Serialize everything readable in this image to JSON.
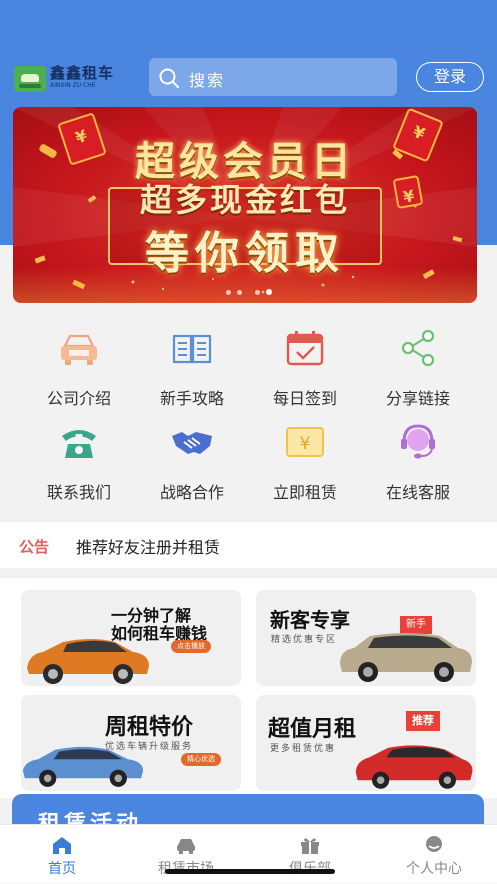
{
  "header": {
    "logo_name": "鑫鑫租车",
    "logo_sub": "XINXIN ZU CHE",
    "search_placeholder": "搜索",
    "login_label": "登录"
  },
  "banner": {
    "line1": "超级会员日",
    "line2": "超多现金红包",
    "line3": "等你领取",
    "slide_count": 4,
    "active_slide": 3
  },
  "menu": {
    "items": [
      {
        "label": "公司介绍",
        "icon": "company-car-icon",
        "color": "#f0a57a"
      },
      {
        "label": "新手攻略",
        "icon": "book-icon",
        "color": "#5b8fd6"
      },
      {
        "label": "每日签到",
        "icon": "calendar-check-icon",
        "color": "#e05a50"
      },
      {
        "label": "分享链接",
        "icon": "share-icon",
        "color": "#6cc070"
      },
      {
        "label": "联系我们",
        "icon": "telephone-icon",
        "color": "#3aa68a"
      },
      {
        "label": "战略合作",
        "icon": "handshake-icon",
        "color": "#4a6fd0"
      },
      {
        "label": "立即租赁",
        "icon": "yen-card-icon",
        "color": "#f2c444"
      },
      {
        "label": "在线客服",
        "icon": "headset-icon",
        "color": "#b06ed0"
      }
    ]
  },
  "notice": {
    "tag": "公告",
    "text": "推荐好友注册并租赁"
  },
  "cards": {
    "c1": {
      "line1": "一分钟了解",
      "line2": "如何租车赚钱",
      "tag": "点击播放"
    },
    "c2": {
      "title": "新客专享",
      "sub": "精选优惠专区",
      "tag": "新手"
    },
    "c3": {
      "title": "周租特价",
      "sub": "优选车辆升级服务",
      "tag": "精心优选"
    },
    "c4": {
      "title": "超值月租",
      "sub": "更多租赁优惠",
      "tag": "推荐"
    }
  },
  "activity": {
    "title": "租赁活动"
  },
  "tabbar": {
    "tabs": [
      {
        "label": "首页",
        "icon": "home-icon",
        "active": true
      },
      {
        "label": "租赁市场",
        "icon": "car-icon",
        "active": false
      },
      {
        "label": "俱乐部",
        "icon": "gift-icon",
        "active": false
      },
      {
        "label": "个人中心",
        "icon": "person-icon",
        "active": false
      }
    ]
  },
  "colors": {
    "primary": "#4a85df",
    "tab_active": "#3d7bd9",
    "notice_tag": "#e0625a"
  }
}
